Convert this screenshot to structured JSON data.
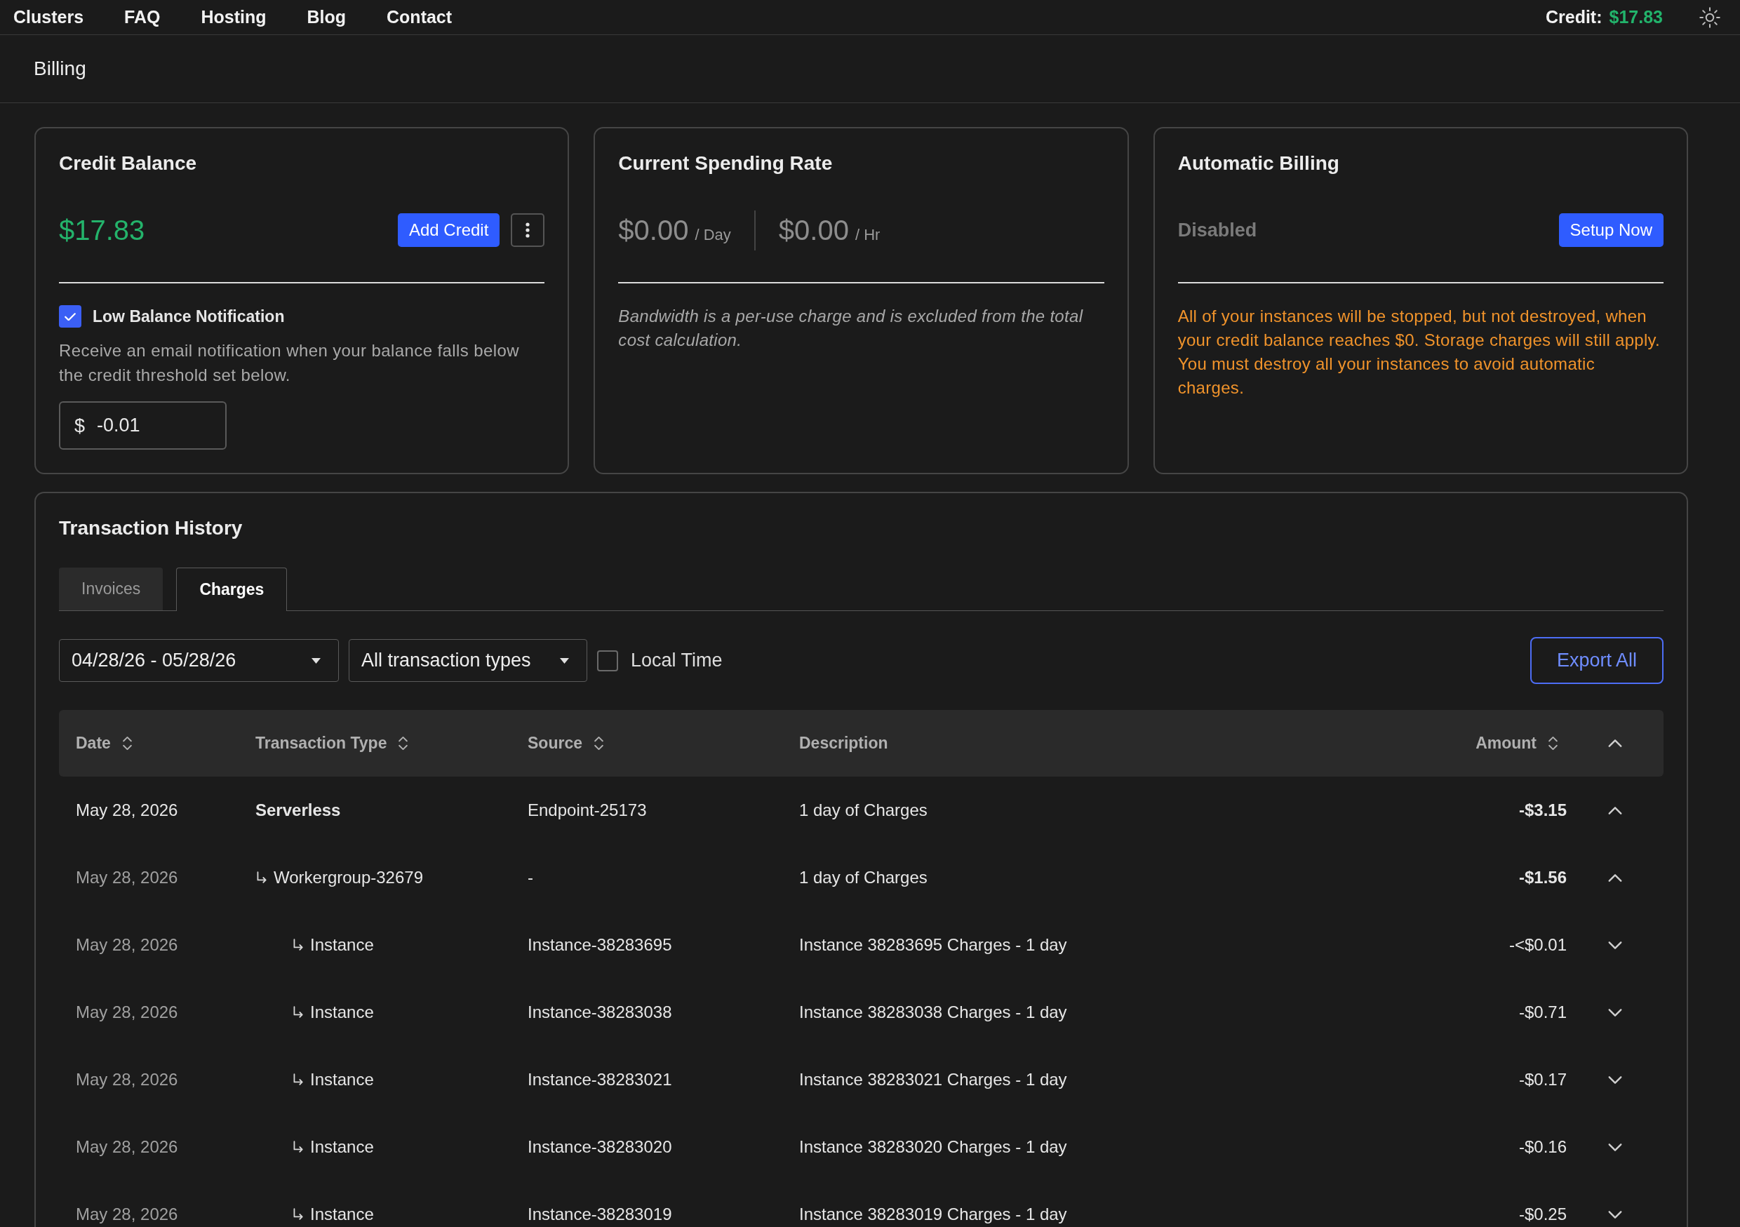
{
  "nav": {
    "links": [
      {
        "label": "Clusters"
      },
      {
        "label": "FAQ"
      },
      {
        "label": "Hosting"
      },
      {
        "label": "Blog"
      },
      {
        "label": "Contact"
      }
    ],
    "credit": {
      "label": "Credit:",
      "value": "$17.83"
    }
  },
  "page_title": "Billing",
  "credit_balance": {
    "title": "Credit Balance",
    "amount": "$17.83",
    "add_button": "Add Credit",
    "notification": {
      "label": "Low Balance Notification",
      "checked": true,
      "description": "Receive an email notification when your balance falls below the credit threshold set below.",
      "currency": "$",
      "threshold": "-0.01"
    }
  },
  "spending_rate": {
    "title": "Current Spending Rate",
    "rates": [
      {
        "amount": "$0.00",
        "unit": "/ Day"
      },
      {
        "amount": "$0.00",
        "unit": "/ Hr"
      }
    ],
    "note": "Bandwidth is a per-use charge and is excluded from the total cost calculation."
  },
  "automatic_billing": {
    "title": "Automatic Billing",
    "status": "Disabled",
    "setup_button": "Setup Now",
    "warning": "All of your instances will be stopped, but not destroyed, when your credit balance reaches $0. Storage charges will still apply. You must destroy all your instances to avoid automatic charges."
  },
  "transactions": {
    "title": "Transaction History",
    "tabs": [
      {
        "label": "Invoices",
        "selected": false
      },
      {
        "label": "Charges",
        "selected": true
      }
    ],
    "filters": {
      "date_range": "04/28/26 - 05/28/26",
      "type": "All transaction types",
      "local_time": {
        "label": "Local Time",
        "checked": false
      }
    },
    "export_button": "Export All",
    "table": {
      "columns": [
        {
          "label": "Date",
          "sortable": true
        },
        {
          "label": "Transaction Type",
          "sortable": true
        },
        {
          "label": "Source",
          "sortable": true
        },
        {
          "label": "Description",
          "sortable": false
        },
        {
          "label": "Amount",
          "sortable": true
        }
      ],
      "expanded": true,
      "rows": [
        {
          "date": "May 28, 2026",
          "type": "Serverless",
          "source": "Endpoint-25173",
          "description": "1 day of Charges",
          "amount": "-$3.15",
          "expanded": true,
          "children": [
            {
              "date": "May 28, 2026",
              "type": "Workergroup-32679",
              "source": "-",
              "description": "1 day of Charges",
              "amount": "-$1.56",
              "expanded": true,
              "children": [
                {
                  "date": "May 28, 2026",
                  "type": "Instance",
                  "source": "Instance-38283695",
                  "description": "Instance 38283695 Charges - 1 day",
                  "amount": "-<$0.01",
                  "expanded": false
                },
                {
                  "date": "May 28, 2026",
                  "type": "Instance",
                  "source": "Instance-38283038",
                  "description": "Instance 38283038 Charges - 1 day",
                  "amount": "-$0.71",
                  "expanded": false
                },
                {
                  "date": "May 28, 2026",
                  "type": "Instance",
                  "source": "Instance-38283021",
                  "description": "Instance 38283021 Charges - 1 day",
                  "amount": "-$0.17",
                  "expanded": false
                },
                {
                  "date": "May 28, 2026",
                  "type": "Instance",
                  "source": "Instance-38283020",
                  "description": "Instance 38283020 Charges - 1 day",
                  "amount": "-$0.16",
                  "expanded": false
                },
                {
                  "date": "May 28, 2026",
                  "type": "Instance",
                  "source": "Instance-38283019",
                  "description": "Instance 38283019 Charges - 1 day",
                  "amount": "-$0.25",
                  "expanded": false
                }
              ]
            }
          ]
        }
      ]
    }
  }
}
